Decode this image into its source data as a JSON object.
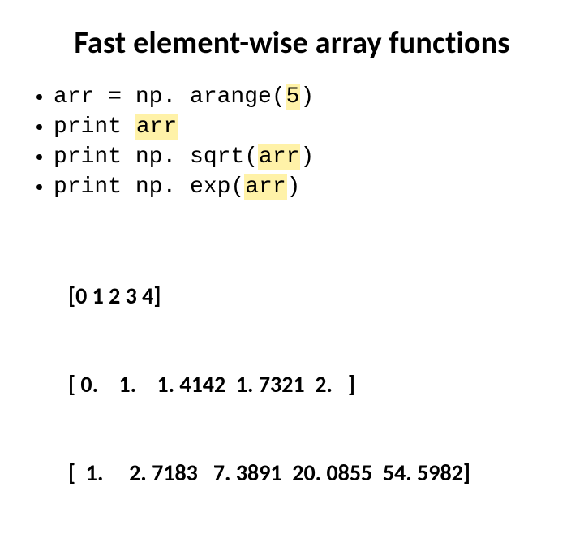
{
  "title": "Fast element-wise array functions",
  "code": {
    "line1": {
      "pre": "arr = np. arange(",
      "hl": "5",
      "post": ")"
    },
    "line2": {
      "pre": "print ",
      "hl": "arr",
      "post": ""
    },
    "line3": {
      "pre": "print np. sqrt(",
      "hl": "arr",
      "post": ")"
    },
    "line4": {
      "pre": "print np. exp(",
      "hl": "arr",
      "post": ")"
    }
  },
  "output": {
    "line1": "[0 1 2 3 4]",
    "line2": "[ 0.    1.    1. 4142  1. 7321  2.   ]",
    "line3": "[  1.     2. 7183   7. 3891  20. 0855  54. 5982]"
  }
}
